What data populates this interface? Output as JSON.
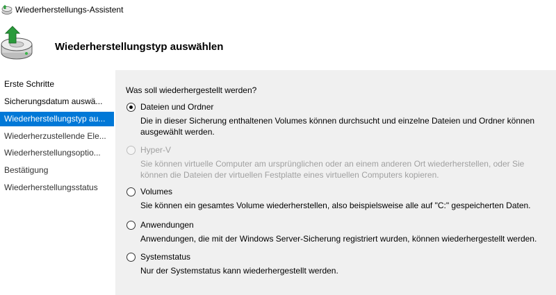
{
  "window": {
    "title": "Wiederherstellungs-Assistent"
  },
  "header": {
    "heading": "Wiederherstellungstyp auswählen"
  },
  "sidebar": {
    "items": [
      {
        "label": "Erste Schritte"
      },
      {
        "label": "Sicherungsdatum auswä..."
      },
      {
        "label": "Wiederherstellungstyp au..."
      },
      {
        "label": "Wiederherzustellende Ele..."
      },
      {
        "label": "Wiederherstellungsoptio..."
      },
      {
        "label": "Bestätigung"
      },
      {
        "label": "Wiederherstellungsstatus"
      }
    ],
    "active_index": 2
  },
  "main": {
    "question": "Was soll wiederhergestellt werden?",
    "options": [
      {
        "label": "Dateien und Ordner",
        "description": "Die in dieser Sicherung enthaltenen Volumes können durchsucht und einzelne Dateien und Ordner können ausgewählt werden.",
        "selected": true,
        "enabled": true
      },
      {
        "label": "Hyper-V",
        "description": "Sie können virtuelle Computer am ursprünglichen oder an einem anderen Ort wiederherstellen, oder Sie können die Dateien der virtuellen Festplatte eines virtuellen Computers kopieren.",
        "selected": false,
        "enabled": false
      },
      {
        "label": "Volumes",
        "description": "Sie können ein gesamtes Volume wiederherstellen, also beispielsweise alle auf \"C:\" gespeicherten Daten.",
        "selected": false,
        "enabled": true
      },
      {
        "label": "Anwendungen",
        "description": "Anwendungen, die mit der Windows Server-Sicherung registriert wurden, können wiederhergestellt werden.",
        "selected": false,
        "enabled": true
      },
      {
        "label": "Systemstatus",
        "description": "Nur der Systemstatus kann wiederhergestellt werden.",
        "selected": false,
        "enabled": true
      }
    ]
  },
  "colors": {
    "accent": "#0078d7",
    "content_bg": "#f0f0f0",
    "disabled_text": "#a0a0a0"
  }
}
